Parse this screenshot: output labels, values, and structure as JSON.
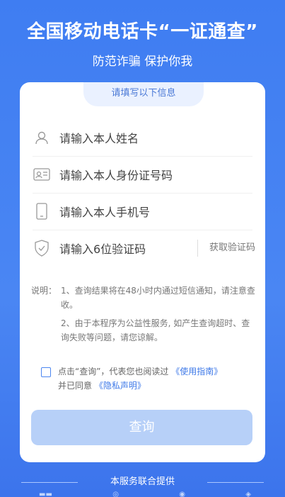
{
  "header": {
    "title": "全国移动电话卡“一证通查”",
    "subtitle": "防范诈骗 保护你我"
  },
  "form": {
    "tab": "请填写以下信息",
    "name_placeholder": "请输入本人姓名",
    "id_placeholder": "请输入本人身份证号码",
    "phone_placeholder": "请输入本人手机号",
    "code_placeholder": "请输入6位验证码",
    "code_button": "获取验证码",
    "notes_label": "说明：",
    "note_1": "1、查询结果将在48小时内通过短信通知，请注意查收。",
    "note_2": "2、由于本程序为公益性服务, 如产生查询超时、查询失败等问题，请您谅解。",
    "agree_prefix": "点击“查询”，代表您也阅读过",
    "terms_link": "《使用指南》",
    "agree_middle": "并已同意",
    "privacy_link": "《隐私声明》",
    "submit": "查询"
  },
  "footer": {
    "text": "本服务联合提供"
  },
  "colors": {
    "background": "#3f7df2",
    "link": "#3e79e8",
    "button": "#b7d0f8"
  }
}
